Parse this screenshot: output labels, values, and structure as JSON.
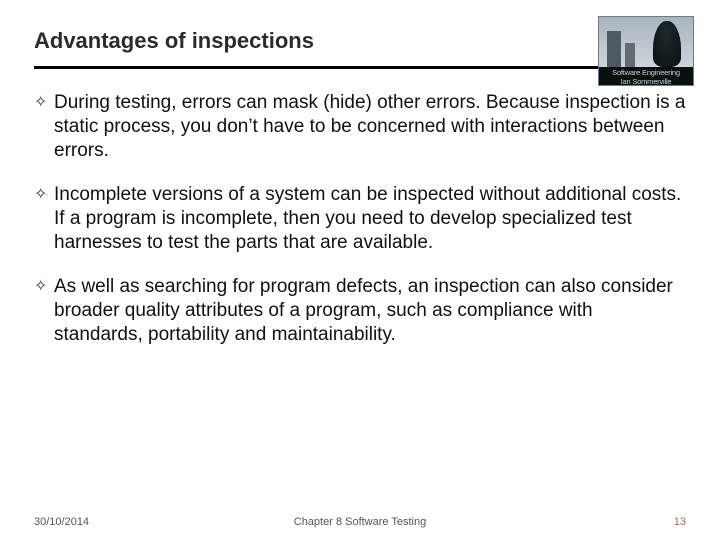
{
  "header": {
    "title": "Advantages of inspections",
    "logo": {
      "line1": "Software Engineering",
      "line2": "Ian Sommerville"
    }
  },
  "bullets": [
    {
      "marker": "✧",
      "text": "During testing, errors can mask (hide) other errors. Because inspection is a static process, you don’t have to be concerned with interactions between errors."
    },
    {
      "marker": "✧",
      "text": "Incomplete versions of a system can be inspected without additional costs. If a program is incomplete, then you need to develop specialized test harnesses to test the parts that are available."
    },
    {
      "marker": "✧",
      "text": "As well as searching for program defects, an inspection can also consider broader quality attributes of a program, such as compliance with standards, portability and maintainability."
    }
  ],
  "footer": {
    "date": "30/10/2014",
    "chapter": "Chapter 8 Software Testing",
    "page": "13"
  }
}
